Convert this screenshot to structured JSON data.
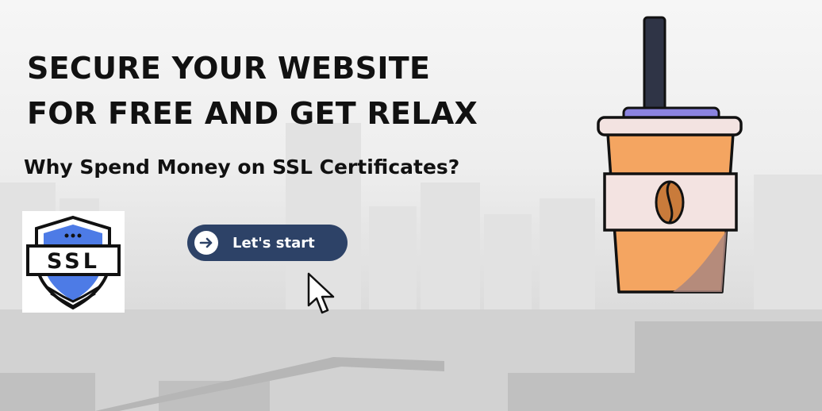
{
  "banner": {
    "headline_line1": "SECURE YOUR WEBSITE",
    "headline_line2": "FOR FREE AND GET RELAX",
    "subheadline": "Why Spend Money on SSL Certificates?",
    "badge_text": "SSL",
    "cta_label": "Let's start"
  },
  "colors": {
    "navy": "#2d4267",
    "badge_blue": "#4d7be6",
    "cup_orange": "#f4a561",
    "cup_lid": "#f3e3e1",
    "straw": "#2f3446",
    "bean": "#c97b3b"
  },
  "icons": [
    "shield-icon",
    "arrow-right-icon",
    "mouse-pointer-icon",
    "coffee-cup-icon",
    "coffee-bean-icon"
  ]
}
